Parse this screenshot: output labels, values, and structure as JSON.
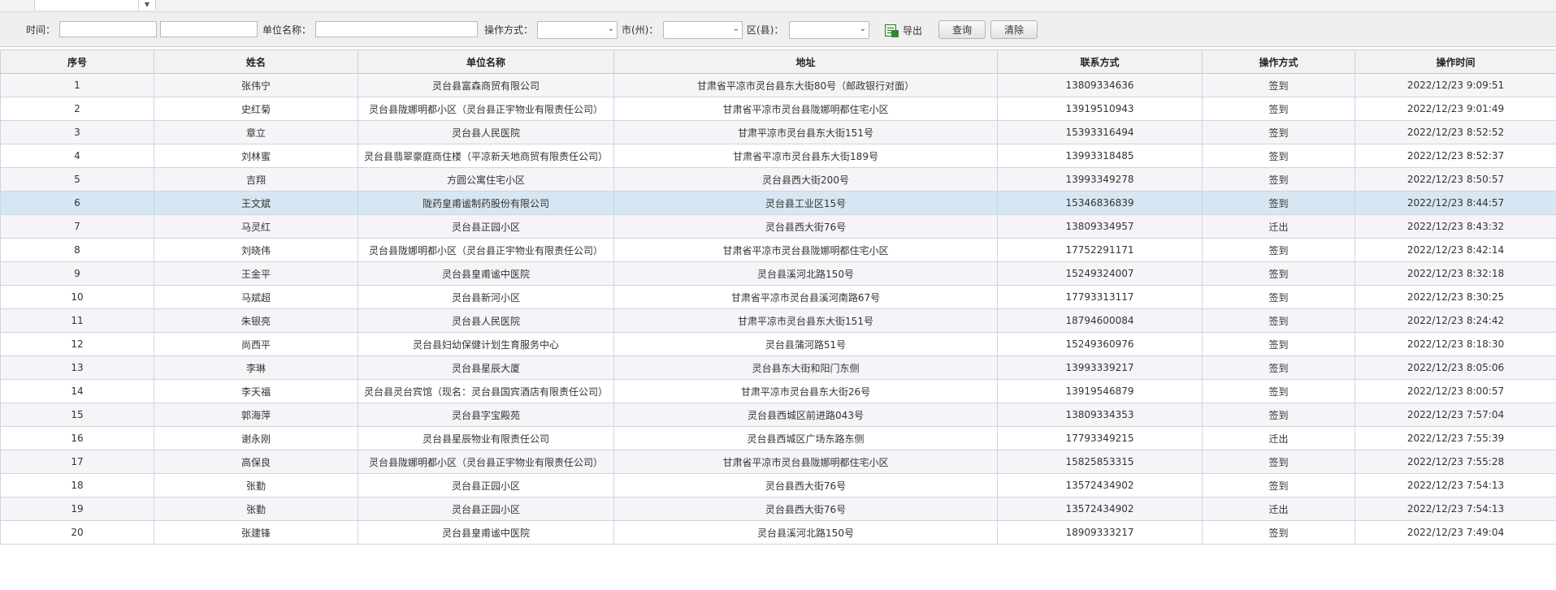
{
  "filters": {
    "time_label": "时间：",
    "unit_label": "单位名称：",
    "op_label": "操作方式：",
    "city_label": "市(州)：",
    "county_label": "区(县)：",
    "export_label": "导出",
    "query_label": "查询",
    "clear_label": "清除"
  },
  "columns": [
    "序号",
    "姓名",
    "单位名称",
    "地址",
    "联系方式",
    "操作方式",
    "操作时间"
  ],
  "selected_row": 6,
  "rows": [
    [
      "1",
      "张伟宁",
      "灵台县富森商贸有限公司",
      "甘肃省平凉市灵台县东大街80号（邮政银行对面）",
      "13809334636",
      "签到",
      "2022/12/23 9:09:51"
    ],
    [
      "2",
      "史红菊",
      "灵台县陇娜明都小区（灵台县正宇物业有限责任公司）",
      "甘肃省平凉市灵台县陇娜明都住宅小区",
      "13919510943",
      "签到",
      "2022/12/23 9:01:49"
    ],
    [
      "3",
      "章立",
      "灵台县人民医院",
      "甘肃平凉市灵台县东大街151号",
      "15393316494",
      "签到",
      "2022/12/23 8:52:52"
    ],
    [
      "4",
      "刘林蜜",
      "灵台县翡翠豪庭商住楼（平凉新天地商贸有限责任公司）",
      "甘肃省平凉市灵台县东大街189号",
      "13993318485",
      "签到",
      "2022/12/23 8:52:37"
    ],
    [
      "5",
      "吉翔",
      "方圆公寓住宅小区",
      "灵台县西大街200号",
      "13993349278",
      "签到",
      "2022/12/23 8:50:57"
    ],
    [
      "6",
      "王文斌",
      "陇药皇甫谧制药股份有限公司",
      "灵台县工业区15号",
      "15346836839",
      "签到",
      "2022/12/23 8:44:57"
    ],
    [
      "7",
      "马灵红",
      "灵台县正园小区",
      "灵台县西大街76号",
      "13809334957",
      "迁出",
      "2022/12/23 8:43:32"
    ],
    [
      "8",
      "刘晓伟",
      "灵台县陇娜明都小区（灵台县正宇物业有限责任公司）",
      "甘肃省平凉市灵台县陇娜明都住宅小区",
      "17752291171",
      "签到",
      "2022/12/23 8:42:14"
    ],
    [
      "9",
      "王金平",
      "灵台县皇甫谧中医院",
      "灵台县溪河北路150号",
      "15249324007",
      "签到",
      "2022/12/23 8:32:18"
    ],
    [
      "10",
      "马斌超",
      "灵台县新河小区",
      "甘肃省平凉市灵台县溪河南路67号",
      "17793313117",
      "签到",
      "2022/12/23 8:30:25"
    ],
    [
      "11",
      "朱银亮",
      "灵台县人民医院",
      "甘肃平凉市灵台县东大街151号",
      "18794600084",
      "签到",
      "2022/12/23 8:24:42"
    ],
    [
      "12",
      "尚西平",
      "灵台县妇幼保健计划生育服务中心",
      "灵台县蒲河路51号",
      "15249360976",
      "签到",
      "2022/12/23 8:18:30"
    ],
    [
      "13",
      "李琳",
      "灵台县星辰大厦",
      "灵台县东大街和阳门东侧",
      "13993339217",
      "签到",
      "2022/12/23 8:05:06"
    ],
    [
      "14",
      "李天福",
      "灵台县灵台宾馆（现名：灵台县国宾酒店有限责任公司）",
      "甘肃平凉市灵台县东大街26号",
      "13919546879",
      "签到",
      "2022/12/23 8:00:57"
    ],
    [
      "15",
      "郭海萍",
      "灵台县字宝殿苑",
      "灵台县西城区前进路043号",
      "13809334353",
      "签到",
      "2022/12/23 7:57:04"
    ],
    [
      "16",
      "谢永刚",
      "灵台县星辰物业有限责任公司",
      "灵台县西城区广场东路东侧",
      "17793349215",
      "迁出",
      "2022/12/23 7:55:39"
    ],
    [
      "17",
      "高保良",
      "灵台县陇娜明都小区（灵台县正宇物业有限责任公司）",
      "甘肃省平凉市灵台县陇娜明都住宅小区",
      "15825853315",
      "签到",
      "2022/12/23 7:55:28"
    ],
    [
      "18",
      "张勤",
      "灵台县正园小区",
      "灵台县西大街76号",
      "13572434902",
      "签到",
      "2022/12/23 7:54:13"
    ],
    [
      "19",
      "张勤",
      "灵台县正园小区",
      "灵台县西大街76号",
      "13572434902",
      "迁出",
      "2022/12/23 7:54:13"
    ],
    [
      "20",
      "张建锋",
      "灵台县皇甫谧中医院",
      "灵台县溪河北路150号",
      "18909333217",
      "签到",
      "2022/12/23 7:49:04"
    ]
  ]
}
